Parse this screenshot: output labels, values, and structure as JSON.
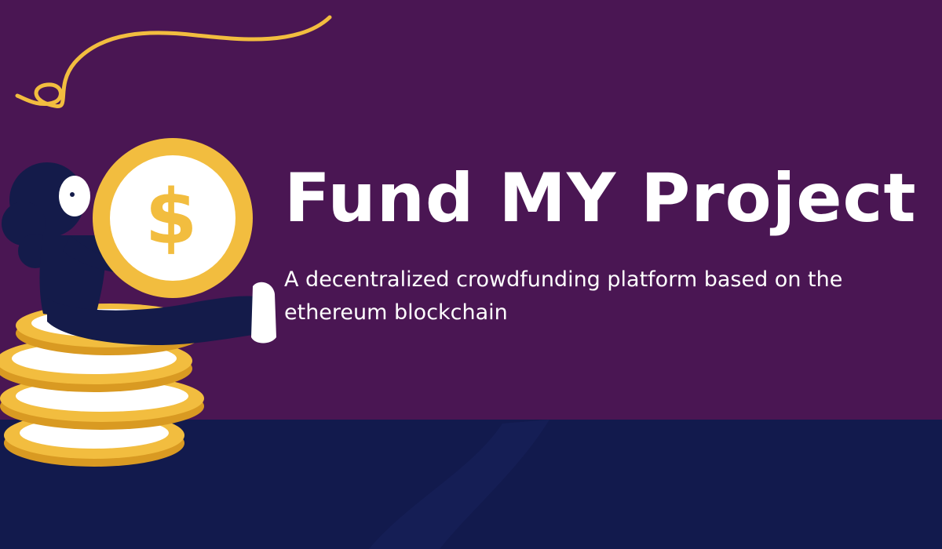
{
  "banner": {
    "title": "Fund MY Project",
    "subtitle_line1": "A decentralized crowdfunding platform based on the",
    "subtitle_line2": "ethereum blockchain"
  },
  "icons": {
    "coin_symbol": "$",
    "illustration": "woman-sitting-on-coin-stack-illustration",
    "decoration": "squiggle-line"
  },
  "colors": {
    "background_top": "#4a1653",
    "background_bottom": "#121a4d",
    "gold": "#f2bd3f",
    "text": "#ffffff"
  }
}
